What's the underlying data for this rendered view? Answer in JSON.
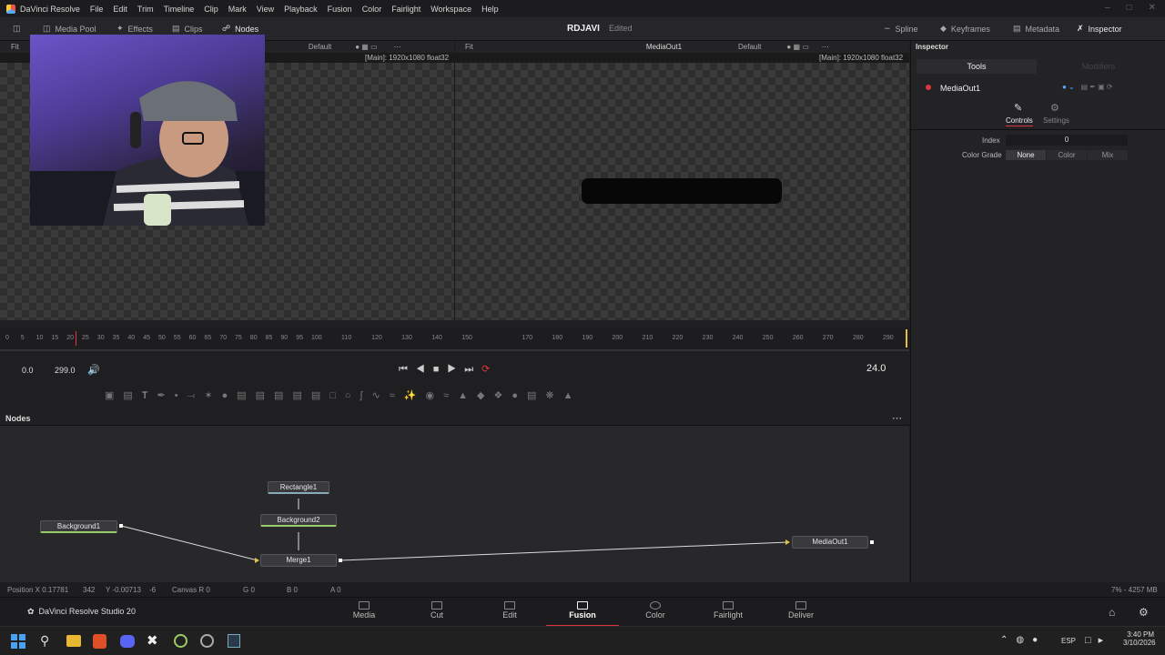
{
  "app": {
    "title": "DaVinci Resolve"
  },
  "menu": [
    "File",
    "Edit",
    "Trim",
    "Timeline",
    "Clip",
    "Mark",
    "View",
    "Playback",
    "Fusion",
    "Color",
    "Fairlight",
    "Workspace",
    "Help"
  ],
  "toolbar": {
    "media_pool": "Media Pool",
    "effects": "Effects",
    "clips": "Clips",
    "nodes": "Nodes",
    "project": "RDJAVI",
    "edited": "Edited",
    "spline": "Spline",
    "keyframes": "Keyframes",
    "metadata": "Metadata",
    "inspector": "Inspector"
  },
  "viewer_left": {
    "fit": "Fit",
    "lut": "Default",
    "info": "[Main]: 1920x1080 float32"
  },
  "viewer_right": {
    "fit": "Fit",
    "name": "MediaOut1",
    "lut": "Default",
    "info": "[Main]: 1920x1080 float32"
  },
  "ruler_ticks": [
    "0",
    "5",
    "10",
    "15",
    "20",
    "25",
    "30",
    "35",
    "40",
    "45",
    "50",
    "55",
    "60",
    "65",
    "70",
    "75",
    "80",
    "85",
    "90",
    "95",
    "100",
    "110",
    "120",
    "130",
    "140",
    "150",
    "170",
    "180",
    "190",
    "200",
    "210",
    "220",
    "230",
    "240",
    "250",
    "260",
    "270",
    "280",
    "290"
  ],
  "transport": {
    "start": "0.0",
    "end": "299.0",
    "fps": "24.0"
  },
  "nodes_panel": {
    "title": "Nodes"
  },
  "nodes": {
    "rectangle1": "Rectangle1",
    "background2": "Background2",
    "background1": "Background1",
    "merge1": "Merge1",
    "mediaout1": "MediaOut1"
  },
  "status": {
    "pos_x": "Position X 0.17781",
    "px": "342",
    "pos_y": "Y -0.00713",
    "py": "-6",
    "canvas": "Canvas R 0",
    "g": "G 0",
    "b": "B 0",
    "a": "A 0",
    "mem": "7% - 4257 MB"
  },
  "brand": "DaVinci Resolve Studio 20",
  "pages": [
    "Media",
    "Cut",
    "Edit",
    "Fusion",
    "Color",
    "Fairlight",
    "Deliver"
  ],
  "inspector": {
    "title": "Inspector",
    "tab_tools": "Tools",
    "tab_modifiers": "Modifiers",
    "tool_name": "MediaOut1",
    "controls": "Controls",
    "settings": "Settings",
    "index_label": "Index",
    "index_value": "0",
    "grade_label": "Color Grade",
    "grade_none": "None",
    "grade_color": "Color",
    "grade_mix": "Mix"
  },
  "taskbar": {
    "lang": "ESP",
    "time": "3:40 PM",
    "date": "3/10/2026"
  },
  "colors": {
    "accent": "#e0343e",
    "bg": "#1f1f22"
  }
}
